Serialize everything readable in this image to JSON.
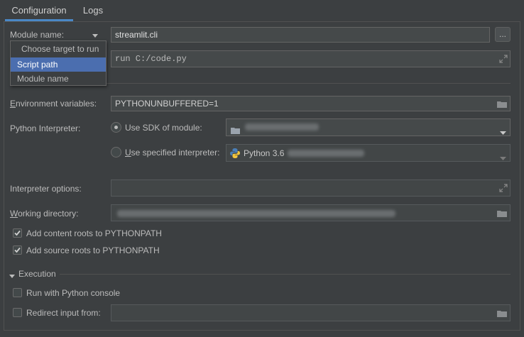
{
  "tabs": [
    {
      "label": "Configuration"
    },
    {
      "label": "Logs"
    }
  ],
  "module": {
    "label": "Module name:",
    "value": "streamlit.cli",
    "browse_label": "..."
  },
  "target_popup": {
    "items": [
      {
        "label": "Choose target to run"
      },
      {
        "label": "Script path"
      },
      {
        "label": "Module name"
      }
    ],
    "selected": "Script path"
  },
  "parameters": {
    "value": "run C:/code.py"
  },
  "environment": {
    "label": "Environment variables:",
    "value": "PYTHONUNBUFFERED=1"
  },
  "interpreter": {
    "label": "Python Interpreter:",
    "use_sdk_label": "Use SDK of module:",
    "use_specified_label": "Use specified interpreter:",
    "specified_value": "Python 3.6",
    "selected": "use_sdk"
  },
  "interpreter_options": {
    "label": "Interpreter options:"
  },
  "working_directory": {
    "label": "Working directory:"
  },
  "checkboxes": {
    "content_roots": {
      "label": "Add content roots to PYTHONPATH",
      "checked": true
    },
    "source_roots": {
      "label": "Add source roots to PYTHONPATH",
      "checked": true
    }
  },
  "execution": {
    "header": "Execution",
    "python_console": {
      "label": "Run with Python console",
      "checked": false
    },
    "redirect_input": {
      "label": "Redirect input from:",
      "checked": false
    }
  },
  "colors": {
    "background": "#3c3f41",
    "field": "#45494a",
    "selection": "#4b6eaf",
    "tab_accent": "#4a88c7",
    "text": "#bbbbbb"
  }
}
